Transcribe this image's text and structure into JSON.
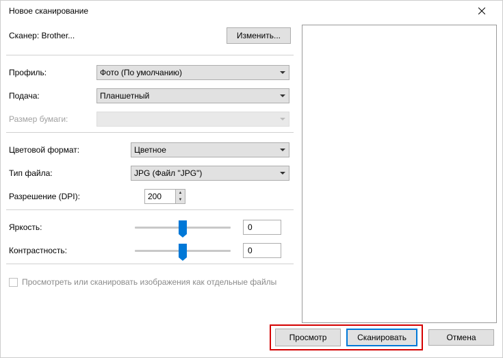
{
  "window": {
    "title": "Новое сканирование"
  },
  "scanner": {
    "label": "Сканер: Brother...",
    "change_btn": "Изменить..."
  },
  "fields": {
    "profile": {
      "label": "Профиль:",
      "value": "Фото (По умолчанию)"
    },
    "feed": {
      "label": "Подача:",
      "value": "Планшетный"
    },
    "paper_size": {
      "label": "Размер бумаги:",
      "value": ""
    },
    "color_format": {
      "label": "Цветовой формат:",
      "value": "Цветное"
    },
    "file_type": {
      "label": "Тип файла:",
      "value": "JPG (Файл \"JPG\")"
    },
    "resolution": {
      "label": "Разрешение (DPI):",
      "value": "200"
    },
    "brightness": {
      "label": "Яркость:",
      "value": "0"
    },
    "contrast": {
      "label": "Контрастность:",
      "value": "0"
    }
  },
  "checkbox": {
    "label": "Просмотреть или сканировать изображения как отдельные файлы"
  },
  "buttons": {
    "preview": "Просмотр",
    "scan": "Сканировать",
    "cancel": "Отмена"
  }
}
